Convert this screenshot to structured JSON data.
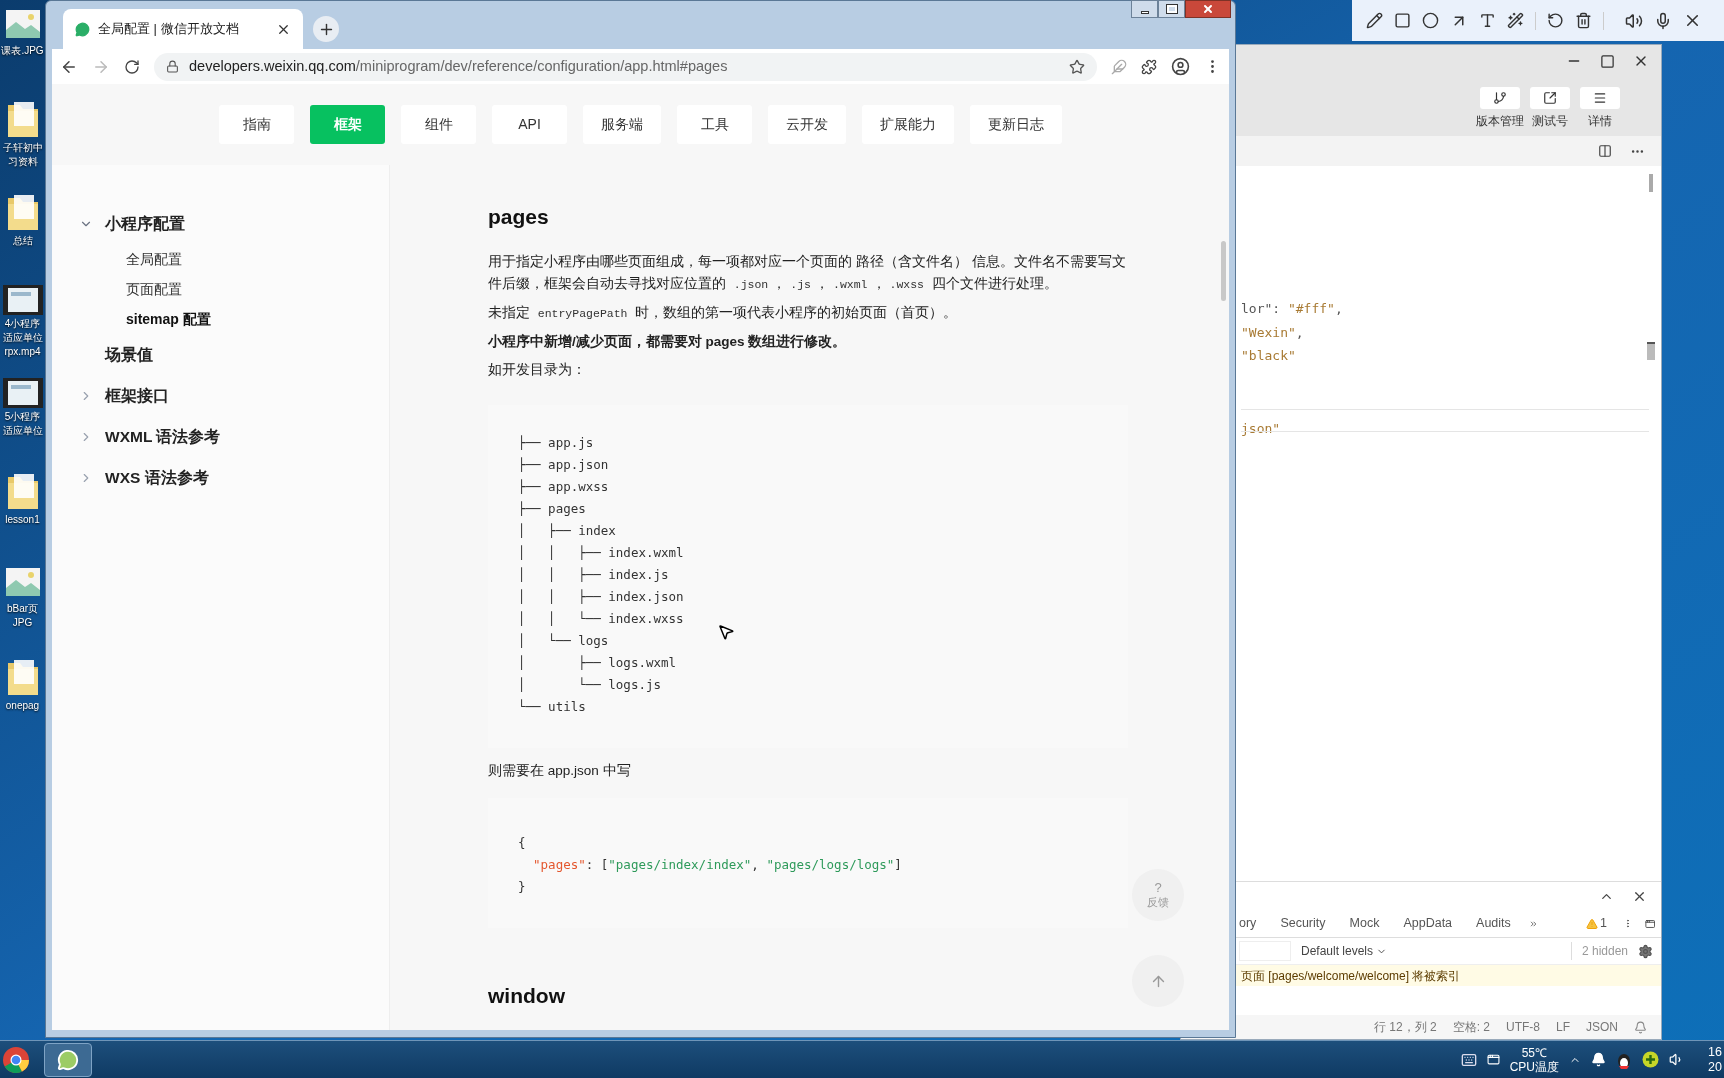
{
  "desktop_icons": [
    {
      "kind": "image",
      "label": [
        "课表.JPG"
      ]
    },
    {
      "kind": "folder",
      "label": [
        "子轩初中",
        "习资料"
      ]
    },
    {
      "kind": "folder",
      "label": [
        "总结"
      ]
    },
    {
      "kind": "video",
      "label": [
        "4小程序",
        "适应单位",
        "rpx.mp4"
      ]
    },
    {
      "kind": "video",
      "label": [
        "5小程序",
        "适应单位"
      ]
    },
    {
      "kind": "folder",
      "label": [
        "lesson1"
      ]
    },
    {
      "kind": "image",
      "label": [
        "bBar页",
        "JPG"
      ]
    },
    {
      "kind": "folder",
      "label": [
        "onepag"
      ]
    }
  ],
  "browser": {
    "tab": {
      "title": "全局配置 | 微信开放文档"
    },
    "url": {
      "host": "developers.weixin.qq.com",
      "path": "/miniprogram/dev/reference/configuration/app.html#pages"
    },
    "nav": [
      {
        "label": "指南",
        "selected": false
      },
      {
        "label": "框架",
        "selected": true
      },
      {
        "label": "组件",
        "selected": false
      },
      {
        "label": "API",
        "selected": false
      },
      {
        "label": "服务端",
        "selected": false
      },
      {
        "label": "工具",
        "selected": false
      },
      {
        "label": "云开发",
        "selected": false
      },
      {
        "label": "扩展能力",
        "selected": false
      },
      {
        "label": "更新日志",
        "selected": false
      }
    ],
    "sidebar": [
      {
        "kind": "group",
        "label": "小程序配置",
        "expanded": true,
        "children": [
          {
            "label": "全局配置",
            "selected": false
          },
          {
            "label": "页面配置",
            "selected": false
          },
          {
            "label": "sitemap 配置",
            "selected": true
          }
        ]
      },
      {
        "kind": "leaf",
        "label": "场景值"
      },
      {
        "kind": "group",
        "label": "框架接口",
        "expanded": false
      },
      {
        "kind": "group",
        "label": "WXML 语法参考",
        "expanded": false
      },
      {
        "kind": "group",
        "label": "WXS 语法参考",
        "expanded": false
      }
    ],
    "content": {
      "heading": "pages",
      "paragraphs": [
        {
          "bold": false,
          "segments": [
            {
              "kind": "text",
              "text": "用于指定小程序由哪些页面组成，每一项都对应一个页面的 路径（含文件名） 信息。文件名不需要写文件后缀，框架会自动去寻找对应位置的 "
            },
            {
              "kind": "code",
              "text": ".json"
            },
            {
              "kind": "text",
              "text": "，"
            },
            {
              "kind": "code",
              "text": ".js"
            },
            {
              "kind": "text",
              "text": "，"
            },
            {
              "kind": "code",
              "text": ".wxml"
            },
            {
              "kind": "text",
              "text": "，"
            },
            {
              "kind": "code",
              "text": ".wxss"
            },
            {
              "kind": "text",
              "text": " 四个文件进行处理。"
            }
          ]
        },
        {
          "bold": false,
          "segments": [
            {
              "kind": "text",
              "text": "未指定 "
            },
            {
              "kind": "code",
              "text": "entryPagePath"
            },
            {
              "kind": "text",
              "text": " 时，数组的第一项代表小程序的初始页面（首页）。"
            }
          ]
        },
        {
          "bold": true,
          "segments": [
            {
              "kind": "text",
              "text": "小程序中新增/减少页面，都需要对 pages 数组进行修改。"
            }
          ]
        },
        {
          "bold": false,
          "segments": [
            {
              "kind": "text",
              "text": "如开发目录为："
            }
          ]
        }
      ],
      "tree": [
        "├── app.js",
        "├── app.json",
        "├── app.wxss",
        "├── pages",
        "│   ├── index",
        "│   │   ├── index.wxml",
        "│   │   ├── index.js",
        "│   │   ├── index.json",
        "│   │   └── index.wxss",
        "│   └── logs",
        "│       ├── logs.wxml",
        "│       └── logs.js",
        "└── utils"
      ],
      "after_tree": "则需要在 app.json 中写",
      "json_code": [
        [
          {
            "kind": "punct",
            "text": "{"
          }
        ],
        [
          {
            "kind": "key",
            "text": "  \"pages\""
          },
          {
            "kind": "punct",
            "text": ": ["
          },
          {
            "kind": "string",
            "text": "\"pages/index/index\""
          },
          {
            "kind": "punct",
            "text": ", "
          },
          {
            "kind": "string",
            "text": "\"pages/logs/logs\""
          },
          {
            "kind": "punct",
            "text": "]"
          }
        ],
        [
          {
            "kind": "punct",
            "text": "}"
          }
        ]
      ],
      "next_heading": "window"
    },
    "feedback": {
      "mark": "?",
      "label": "反馈"
    }
  },
  "ide": {
    "toolbar": [
      {
        "kind": "branch",
        "label": "版本管理"
      },
      {
        "kind": "share",
        "label": "测试号"
      },
      {
        "kind": "menu",
        "label": "详情"
      }
    ],
    "code_blocks": [
      [
        [
          {
            "kind": "key",
            "text": "lor\""
          },
          {
            "kind": "punct",
            "text": ": "
          },
          {
            "kind": "string",
            "text": "\"#fff\""
          },
          {
            "kind": "punct",
            "text": ","
          }
        ],
        [
          {
            "kind": "string",
            "text": "\"Wexin\""
          },
          {
            "kind": "punct",
            "text": ","
          }
        ],
        [
          {
            "kind": "string",
            "text": "\"black\""
          }
        ]
      ],
      [
        [
          {
            "kind": "string",
            "text": "json\""
          }
        ]
      ]
    ],
    "devtools": {
      "tabs": [
        "ory",
        "Security",
        "Mock",
        "AppData",
        "Audits"
      ],
      "warnings": "1",
      "levels": "Default levels",
      "hidden": "2 hidden",
      "message": "页面 [pages/welcome/welcome] 将被索引"
    },
    "status_bar": [
      "行 12，列 2",
      "空格: 2",
      "UTF-8",
      "LF",
      "JSON"
    ]
  },
  "taskbar": {
    "temperature": "55℃",
    "temperature_label": "CPU温度",
    "clock": [
      "16",
      "20"
    ]
  }
}
